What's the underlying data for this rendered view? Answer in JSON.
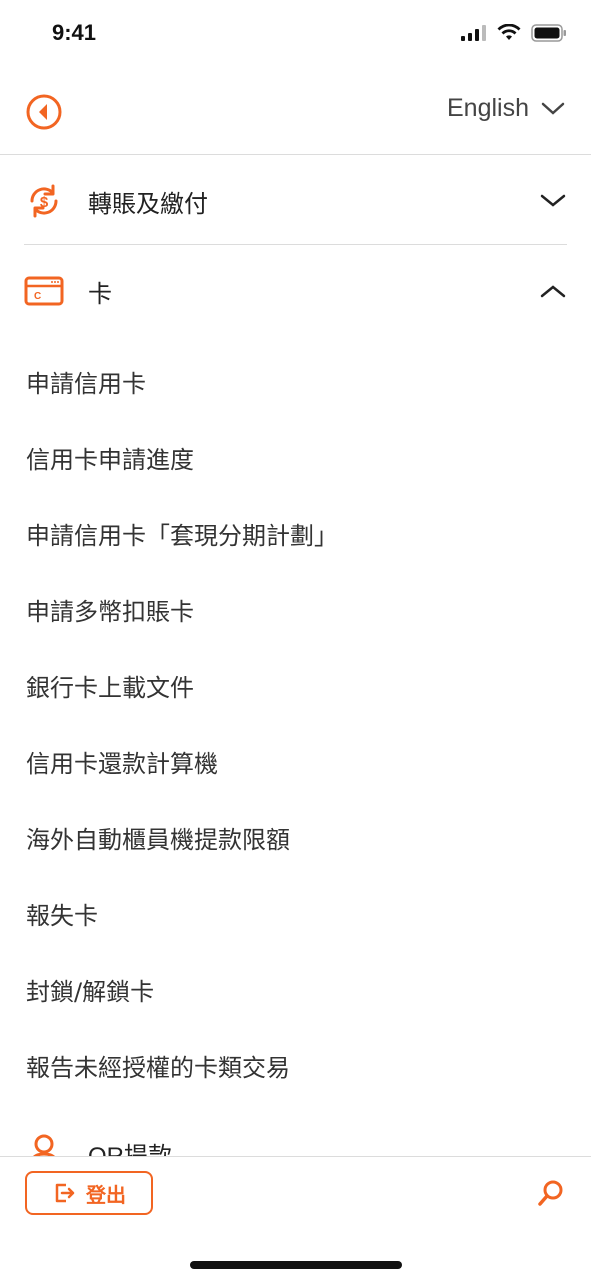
{
  "status_bar": {
    "time": "9:41"
  },
  "top_nav": {
    "language": "English"
  },
  "sections": [
    {
      "label": "轉賬及繳付",
      "icon": "transfer-dollar-icon",
      "expanded": false
    },
    {
      "label": "卡",
      "icon": "card-icon",
      "expanded": true
    }
  ],
  "card_menu": {
    "items": [
      "申請信用卡",
      "信用卡申請進度",
      "申請信用卡「套現分期計劃」",
      "申請多幣扣賬卡",
      "銀行卡上載文件",
      "信用卡還款計算機",
      "海外自動櫃員機提款限額",
      "報失卡",
      "封鎖/解鎖卡",
      "報告未經授權的卡類交易"
    ]
  },
  "partial_section": {
    "label": "QR提款",
    "icon": "person-icon"
  },
  "bottom_bar": {
    "logout_label": "登出"
  },
  "colors": {
    "accent": "#f26522",
    "text": "#333333",
    "divider": "#dcdcdc"
  }
}
